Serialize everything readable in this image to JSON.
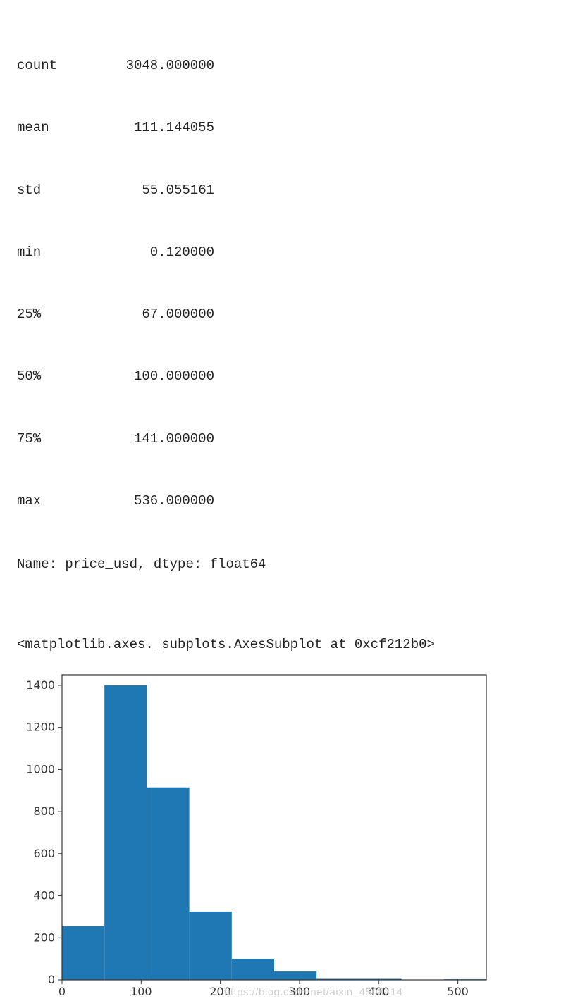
{
  "stats": {
    "rows": [
      {
        "label": "count",
        "value": "3048.000000"
      },
      {
        "label": "mean",
        "value": "111.144055"
      },
      {
        "label": "std",
        "value": "55.055161"
      },
      {
        "label": "min",
        "value": "0.120000"
      },
      {
        "label": "25%",
        "value": "67.000000"
      },
      {
        "label": "50%",
        "value": "100.000000"
      },
      {
        "label": "75%",
        "value": "141.000000"
      },
      {
        "label": "max",
        "value": "536.000000"
      }
    ],
    "footer": "Name: price_usd, dtype: float64"
  },
  "repr": "<matplotlib.axes._subplots.AxesSubplot at 0xcf212b0>",
  "chart_data": {
    "type": "bar",
    "title": "",
    "xlabel": "",
    "ylabel": "",
    "xlim": [
      0,
      536
    ],
    "ylim": [
      0,
      1450
    ],
    "x_ticks": [
      0,
      100,
      200,
      300,
      400,
      500
    ],
    "y_ticks": [
      0,
      200,
      400,
      600,
      800,
      1000,
      1200,
      1400
    ],
    "bin_edges": [
      0,
      53.6,
      107.2,
      160.8,
      214.4,
      268.0,
      321.6,
      375.2,
      428.8,
      482.4,
      536.0
    ],
    "categories": [
      "0–53.6",
      "53.6–107.2",
      "107.2–160.8",
      "160.8–214.4",
      "214.4–268.0",
      "268.0–321.6",
      "321.6–375.2",
      "375.2–428.8",
      "428.8–482.4",
      "482.4–536.0"
    ],
    "values": [
      255,
      1400,
      915,
      325,
      100,
      40,
      5,
      5,
      0,
      3
    ]
  },
  "watermark": "https://blog.csdn.net/aixin_4508414"
}
